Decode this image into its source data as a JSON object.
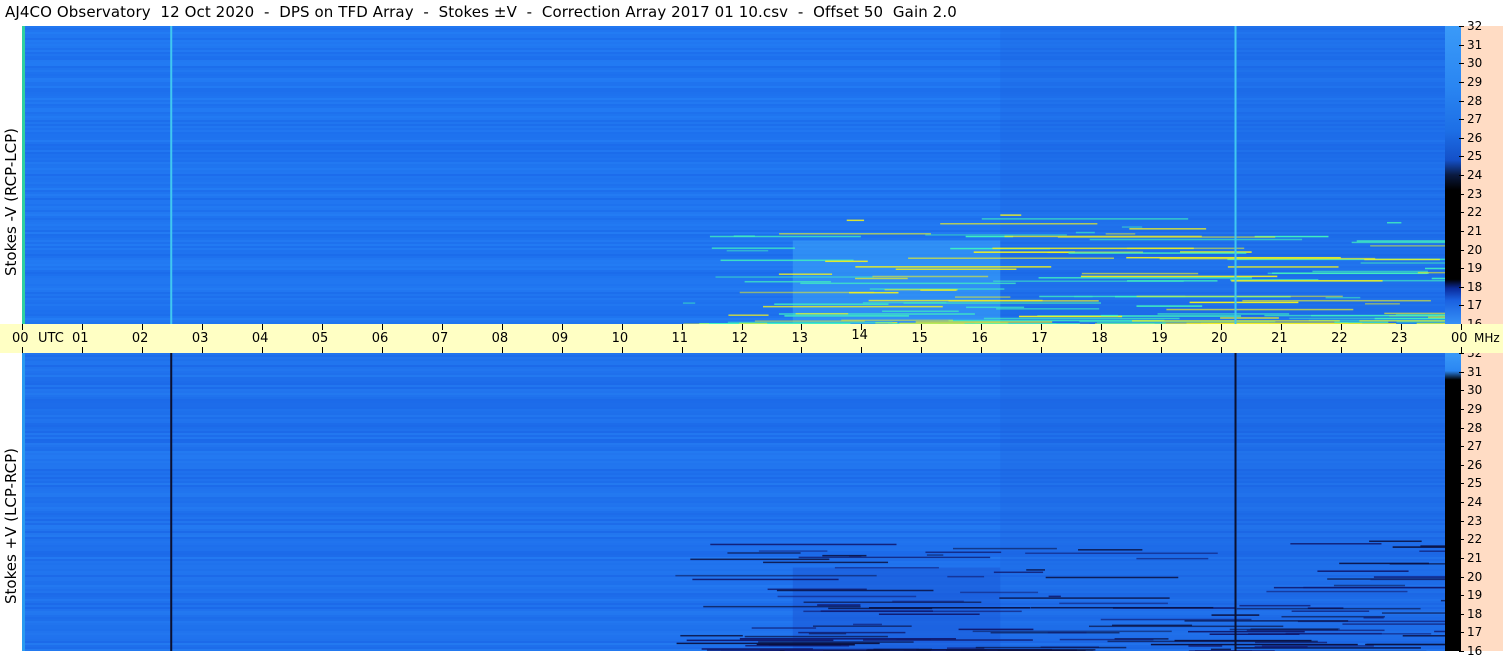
{
  "title": "AJ4CO Observatory  12 Oct 2020  -  DPS on TFD Array  -  Stokes ±V  -  Correction Array 2017 01 10.csv  -  Offset 50  Gain 2.0",
  "chart_data": [
    {
      "type": "heatmap",
      "panel": "top",
      "ylabel": "Stokes -V  (RCP-LCP)",
      "xlabel": "UTC",
      "x_ticks": [
        "00",
        "01",
        "02",
        "03",
        "04",
        "05",
        "06",
        "07",
        "08",
        "09",
        "10",
        "11",
        "12",
        "13",
        "14",
        "15",
        "16",
        "17",
        "18",
        "19",
        "20",
        "21",
        "22",
        "23",
        "00"
      ],
      "y_unit": "MHz",
      "y_ticks": [
        16,
        17,
        18,
        19,
        20,
        21,
        22,
        23,
        24,
        25,
        26,
        27,
        28,
        29,
        30,
        31,
        32
      ],
      "ylim": [
        16,
        32
      ],
      "xlim": [
        0,
        24
      ],
      "vertical_lines_utc": [
        2.5,
        20.45
      ],
      "colors": {
        "background": "#2277f0",
        "hot": "#f0f020",
        "cold": "#0a1a60"
      }
    },
    {
      "type": "heatmap",
      "panel": "bottom",
      "ylabel": "Stokes +V  (LCP-RCP)",
      "xlabel": "UTC",
      "x_ticks": [
        "00",
        "01",
        "02",
        "03",
        "04",
        "05",
        "06",
        "07",
        "08",
        "09",
        "10",
        "11",
        "12",
        "13",
        "14",
        "15",
        "16",
        "17",
        "18",
        "19",
        "20",
        "21",
        "22",
        "23",
        "00"
      ],
      "y_unit": "MHz",
      "y_ticks": [
        16,
        17,
        18,
        19,
        20,
        21,
        22,
        23,
        24,
        25,
        26,
        27,
        28,
        29,
        30,
        31,
        32
      ],
      "ylim": [
        16,
        32
      ],
      "xlim": [
        0,
        24
      ],
      "vertical_lines_utc": [
        2.5,
        20.45
      ],
      "colors": {
        "background": "#2277f0",
        "hot": "#f0f020",
        "cold": "#0a1a60"
      }
    }
  ],
  "axis": {
    "utc_label": "UTC",
    "mhz_label": "MHz"
  }
}
